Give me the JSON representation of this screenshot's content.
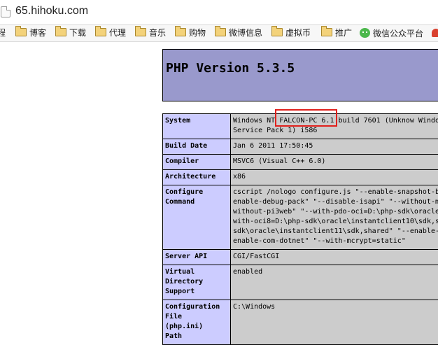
{
  "browser": {
    "address": "65.hihoku.com",
    "bookmarks": [
      {
        "label": "程",
        "icon": "none"
      },
      {
        "label": "博客",
        "icon": "folder-icon"
      },
      {
        "label": "下载",
        "icon": "folder-icon"
      },
      {
        "label": "代理",
        "icon": "folder-icon"
      },
      {
        "label": "音乐",
        "icon": "folder-icon"
      },
      {
        "label": "购物",
        "icon": "folder-icon"
      },
      {
        "label": "微博信息",
        "icon": "folder-icon"
      },
      {
        "label": "虚拟币",
        "icon": "folder-icon"
      },
      {
        "label": "推广",
        "icon": "folder-icon"
      },
      {
        "label": "微信公众平台",
        "icon": "wechat-icon"
      }
    ]
  },
  "php": {
    "title": "PHP Version 5.3.5",
    "header_color": "#9999cc",
    "label_color": "#ccccff",
    "value_color": "#cccccc",
    "highlight_color": "#e0201c",
    "rows": [
      {
        "key": "System",
        "value": "Windows NT FALCON-PC 6.1 build 7601 (Unknow Windo\nService Pack 1) i586"
      },
      {
        "key": "Build Date",
        "value": "Jan 6 2011 17:50:45"
      },
      {
        "key": "Compiler",
        "value": "MSVC6 (Visual C++ 6.0)"
      },
      {
        "key": "Architecture",
        "value": "x86"
      },
      {
        "key": "Configure\nCommand",
        "value": "cscript /nologo configure.js \"--enable-snapshot-b\nenable-debug-pack\" \"--disable-isapi\" \"--without-m\nwithout-pi3web\" \"--with-pdo-oci=D:\\php-sdk\\oracle\nwith-oci8=D:\\php-sdk\\oracle\\instantclient10\\sdk,s\nsdk\\oracle\\instantclient11\\sdk,shared\" \"--enable-\nenable-com-dotnet\" \"--with-mcrypt=static\""
      },
      {
        "key": "Server API",
        "value": "CGI/FastCGI"
      },
      {
        "key": "Virtual\nDirectory\nSupport",
        "value": "enabled"
      },
      {
        "key": "Configuration\nFile\n(php.ini)\nPath",
        "value": "C:\\Windows"
      }
    ]
  }
}
